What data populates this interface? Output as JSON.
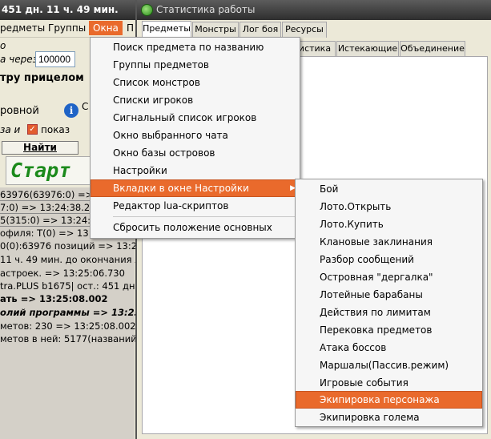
{
  "left_window": {
    "title": "451 дн. 11 ч. 49 мин.",
    "menubar": [
      "редметы",
      "Группы",
      "Окна",
      "П"
    ],
    "label_o": "о",
    "label_cherez": "а через",
    "input_value": "100000",
    "label_pricelom": "тру прицелом",
    "label_rovnoi": "ровной",
    "label_za_i": "за и",
    "label_pokaz": "показ",
    "find_button": "Найти предмет",
    "start_button": "Старт",
    "side_c": "С",
    "log_lines": [
      "63976(63976:0) => 13:2",
      "7:0) => 13:24:38.262",
      "5(315:0) => 13:24:38.30",
      "офиля: Т(0) => 13:24:56",
      "0(0):63976 позиций => 13:24:56.55",
      "11 ч. 49 мин. до окончания лице",
      "астроек. => 13:25:06.730",
      "tra.PLUS b1675| ост.: 451 дн. 11 ч",
      "ать  => 13:25:08.002",
      "олий программы => 13:25:08.0",
      "метов: 230 => 13:25:08.002",
      "метов в ней: 5177(названий:8309"
    ]
  },
  "stats_window": {
    "title": "Статистика работы",
    "tabs": [
      "Предметы",
      "Монстры",
      "Лог боя",
      "Ресурсы"
    ],
    "subtabs": [
      "истика",
      "Истекающие",
      "Объединение"
    ]
  },
  "windows_menu": {
    "items": [
      "Поиск предмета по названию",
      "Группы предметов",
      "Список монстров",
      "Списки игроков",
      "Сигнальный список игроков",
      "Окно выбранного чата",
      "Окно базы островов",
      "Настройки",
      "Вкладки в окне Настройки",
      "Редактор lua-скриптов",
      "Сбросить положение основных"
    ],
    "highlighted_index": 8
  },
  "settings_submenu": {
    "items": [
      "Бой",
      "Лото.Открыть",
      "Лото.Купить",
      "Клановые заклинания",
      "Разбор сообщений",
      "Островная \"дергалка\"",
      "Лотейные барабаны",
      "Действия по лимитам",
      "Перековка предметов",
      "Атака боссов",
      "Маршалы(Пассив.режим)",
      "Игровые события",
      "Экипировка персонажа",
      "Экипировка голема"
    ],
    "highlighted_index": 12
  },
  "colors": {
    "menu_highlight": "#e96a2c",
    "start_text": "#1b8a1b",
    "title_bar": "#3a3a3a"
  }
}
